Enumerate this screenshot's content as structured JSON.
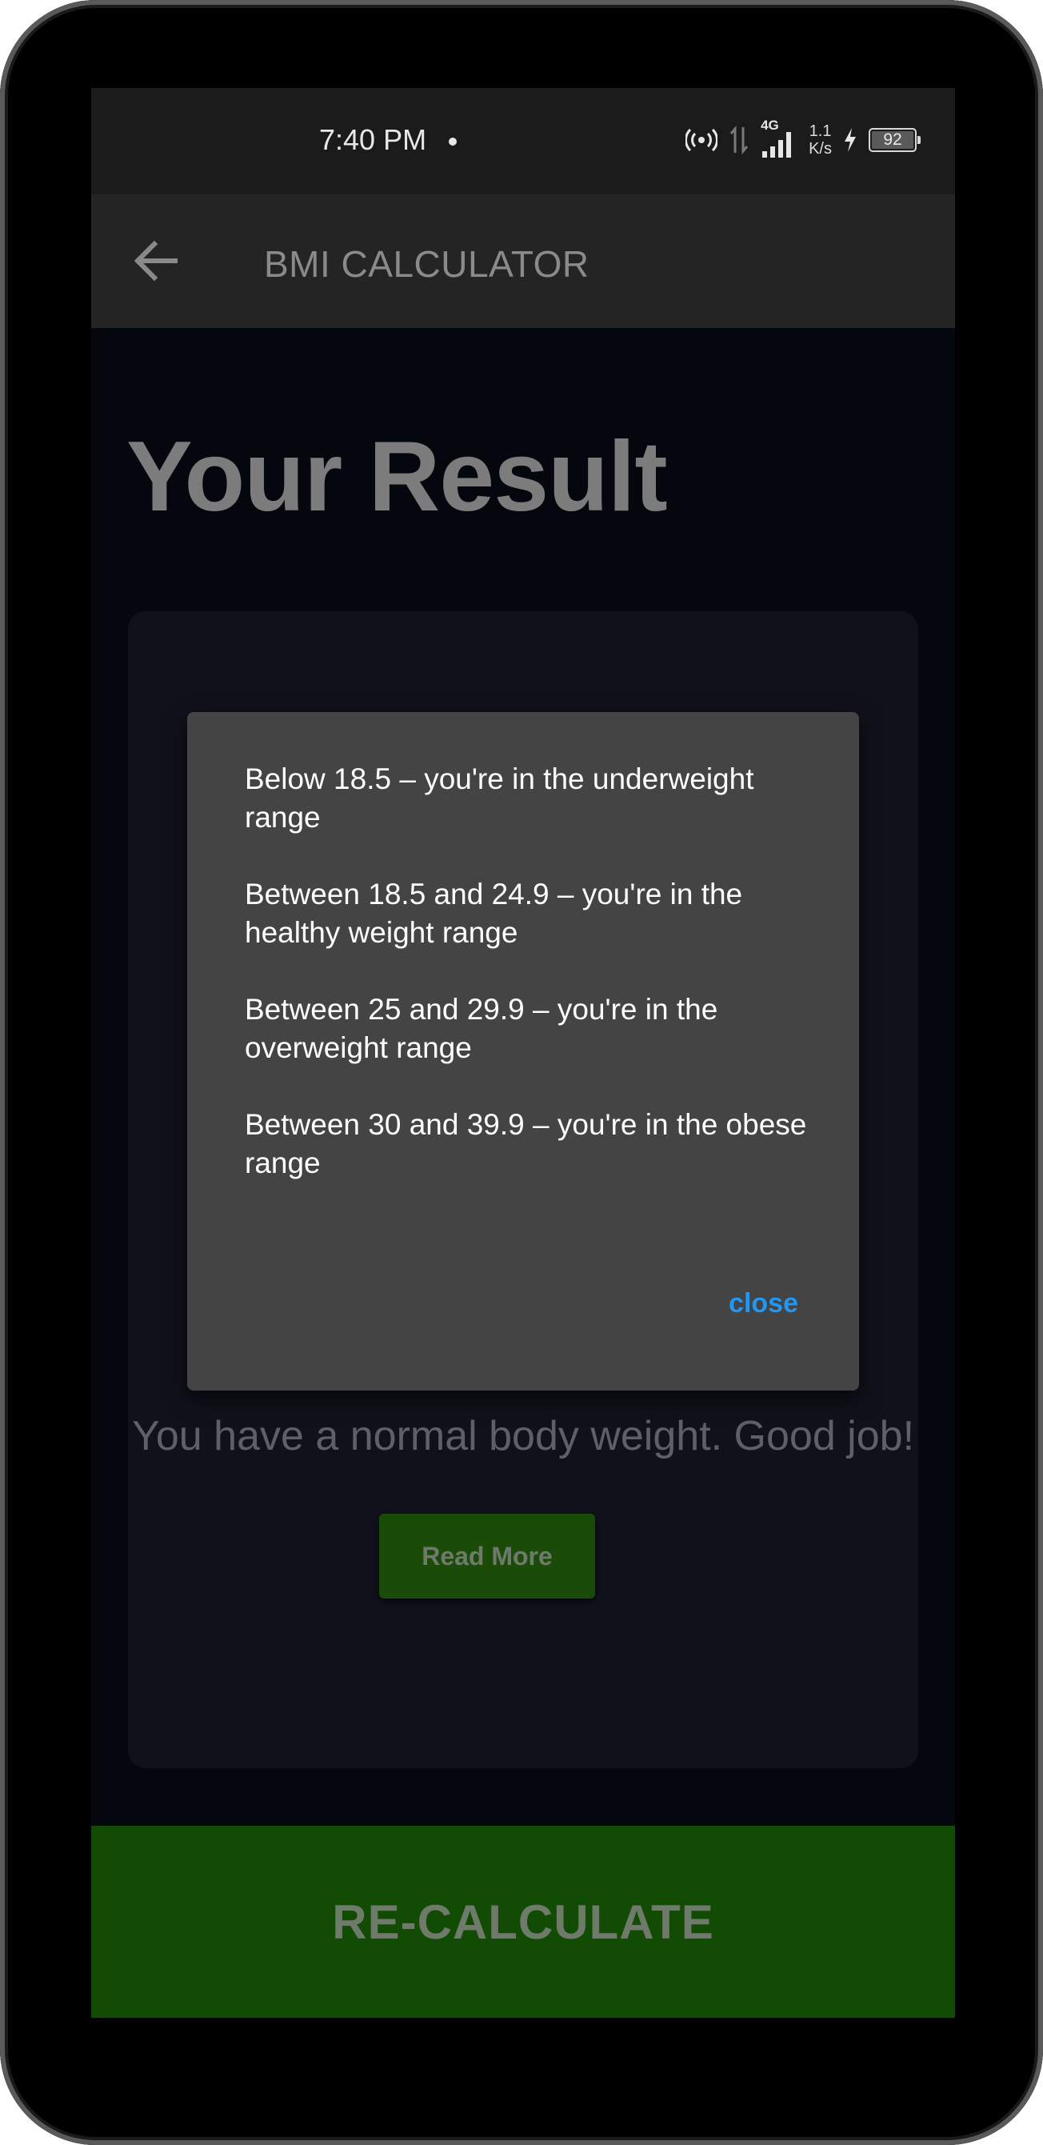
{
  "status_bar": {
    "time": "7:40 PM",
    "network_type": "4G",
    "net_speed_value": "1.1",
    "net_speed_unit": "K/s",
    "battery_level": "92"
  },
  "app_bar": {
    "title": "BMI CALCULATOR"
  },
  "page": {
    "heading": "Your Result",
    "result_message": "You have a normal body weight. Good job!",
    "read_more_label": "Read More",
    "recalculate_label": "RE-CALCULATE"
  },
  "dialog": {
    "ranges": [
      "Below 18.5 – you're in the underweight range",
      "Between 18.5 and 24.9 – you're in the healthy weight range",
      "Between 25 and 29.9 – you're in the overweight range",
      "Between 30 and 39.9 – you're in the obese range"
    ],
    "close_label": "close"
  },
  "colors": {
    "accent_green": "#124b03",
    "dialog_bg": "#444444",
    "link_blue": "#2196f3"
  }
}
